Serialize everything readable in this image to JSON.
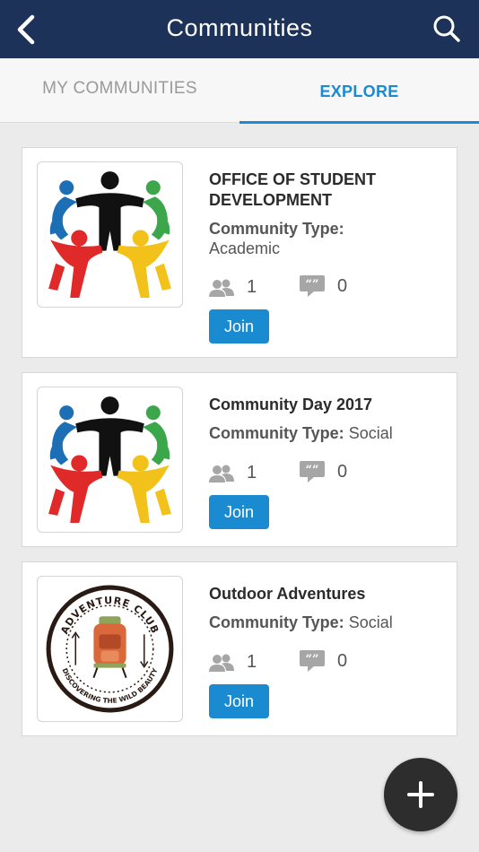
{
  "header": {
    "title": "Communities",
    "back_icon": "chevron-left-icon",
    "search_icon": "search-icon",
    "background": "#1c3258"
  },
  "tabs": [
    {
      "label": "MY COMMUNITIES",
      "active": false
    },
    {
      "label": "EXPLORE",
      "active": true
    }
  ],
  "accent_color": "#1a8bd0",
  "communities": [
    {
      "name": "OFFICE OF STUDENT DEVELOPMENT",
      "type_label": "Community Type:",
      "type_value": "Academic",
      "members": "1",
      "posts": "0",
      "join_label": "Join",
      "image": "people-circle-logo"
    },
    {
      "name": "Community Day 2017",
      "type_label": "Community Type:",
      "type_value": "Social",
      "members": "1",
      "posts": "0",
      "join_label": "Join",
      "image": "people-circle-logo"
    },
    {
      "name": "Outdoor Adventures",
      "type_label": "Community Type:",
      "type_value": "Social",
      "members": "1",
      "posts": "0",
      "join_label": "Join",
      "image": "adventure-club-badge",
      "image_text_top": "ADVENTURE CLUB",
      "image_text_bottom": "DISCOVERING THE WILD BEAUTY"
    }
  ],
  "fab": {
    "icon": "plus-icon"
  }
}
